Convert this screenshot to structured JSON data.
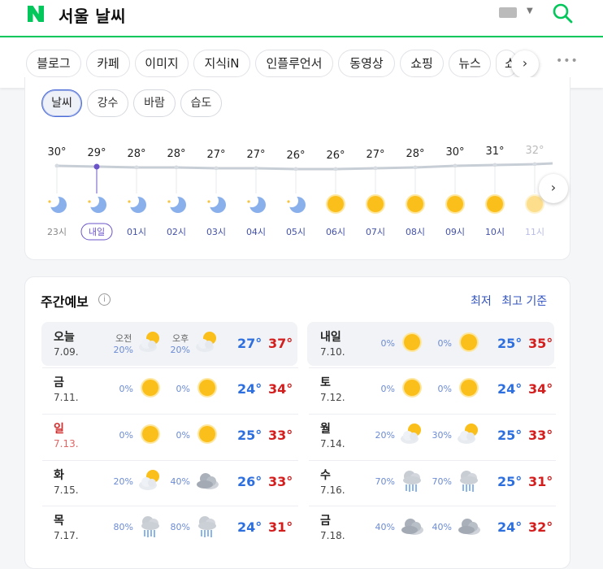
{
  "search": {
    "query": "서울 날씨"
  },
  "tabs": [
    "블로그",
    "카페",
    "이미지",
    "지식iN",
    "인플루언서",
    "동영상",
    "쇼핑",
    "뉴스",
    "쇼"
  ],
  "filters": [
    "날씨",
    "강수",
    "바람",
    "습도"
  ],
  "hourly": [
    {
      "temp": "30°",
      "time": "23시",
      "icon": "moon"
    },
    {
      "temp": "29°",
      "time": "내일",
      "icon": "moon"
    },
    {
      "temp": "28°",
      "time": "01시",
      "icon": "moon"
    },
    {
      "temp": "28°",
      "time": "02시",
      "icon": "moon"
    },
    {
      "temp": "27°",
      "time": "03시",
      "icon": "moon"
    },
    {
      "temp": "27°",
      "time": "04시",
      "icon": "moon"
    },
    {
      "temp": "26°",
      "time": "05시",
      "icon": "moon"
    },
    {
      "temp": "26°",
      "time": "06시",
      "icon": "sun"
    },
    {
      "temp": "27°",
      "time": "07시",
      "icon": "sun"
    },
    {
      "temp": "28°",
      "time": "08시",
      "icon": "sun"
    },
    {
      "temp": "30°",
      "time": "09시",
      "icon": "sun"
    },
    {
      "temp": "31°",
      "time": "10시",
      "icon": "sun"
    },
    {
      "temp": "32°",
      "time": "11시",
      "icon": "sun"
    }
  ],
  "weekly": {
    "title": "주간예보",
    "sort_low": "최저",
    "sort_high": "최고 기준",
    "am_label": "오전",
    "pm_label": "오후",
    "days": [
      {
        "day": "오늘",
        "date": "7.09.",
        "am_pct": "20%",
        "am_icon": "partly",
        "pm_pct": "20%",
        "pm_icon": "partly",
        "low": "27°",
        "high": "37°"
      },
      {
        "day": "내일",
        "date": "7.10.",
        "am_pct": "0%",
        "am_icon": "sun",
        "pm_pct": "0%",
        "pm_icon": "sun",
        "low": "25°",
        "high": "35°"
      },
      {
        "day": "금",
        "date": "7.11.",
        "am_pct": "0%",
        "am_icon": "sun",
        "pm_pct": "0%",
        "pm_icon": "sun",
        "low": "24°",
        "high": "34°"
      },
      {
        "day": "토",
        "date": "7.12.",
        "am_pct": "0%",
        "am_icon": "sun",
        "pm_pct": "0%",
        "pm_icon": "sun",
        "low": "24°",
        "high": "34°"
      },
      {
        "day": "일",
        "date": "7.13.",
        "am_pct": "0%",
        "am_icon": "sun",
        "pm_pct": "0%",
        "pm_icon": "sun",
        "low": "25°",
        "high": "33°",
        "holiday": true
      },
      {
        "day": "월",
        "date": "7.14.",
        "am_pct": "20%",
        "am_icon": "partly",
        "pm_pct": "30%",
        "pm_icon": "partly",
        "low": "25°",
        "high": "33°"
      },
      {
        "day": "화",
        "date": "7.15.",
        "am_pct": "20%",
        "am_icon": "partly",
        "pm_pct": "40%",
        "pm_icon": "cloud",
        "low": "26°",
        "high": "33°"
      },
      {
        "day": "수",
        "date": "7.16.",
        "am_pct": "70%",
        "am_icon": "rain",
        "pm_pct": "70%",
        "pm_icon": "rain",
        "low": "25°",
        "high": "31°"
      },
      {
        "day": "목",
        "date": "7.17.",
        "am_pct": "80%",
        "am_icon": "rain",
        "pm_pct": "80%",
        "pm_icon": "rain",
        "low": "24°",
        "high": "31°"
      },
      {
        "day": "금",
        "date": "7.18.",
        "am_pct": "40%",
        "am_icon": "cloud",
        "pm_pct": "40%",
        "pm_icon": "cloud",
        "low": "24°",
        "high": "32°"
      }
    ]
  },
  "colors": {
    "brand": "#03c75a",
    "low_temp": "#2e6fe0",
    "high_temp": "#d41e1e",
    "accent": "#6b54c8"
  }
}
